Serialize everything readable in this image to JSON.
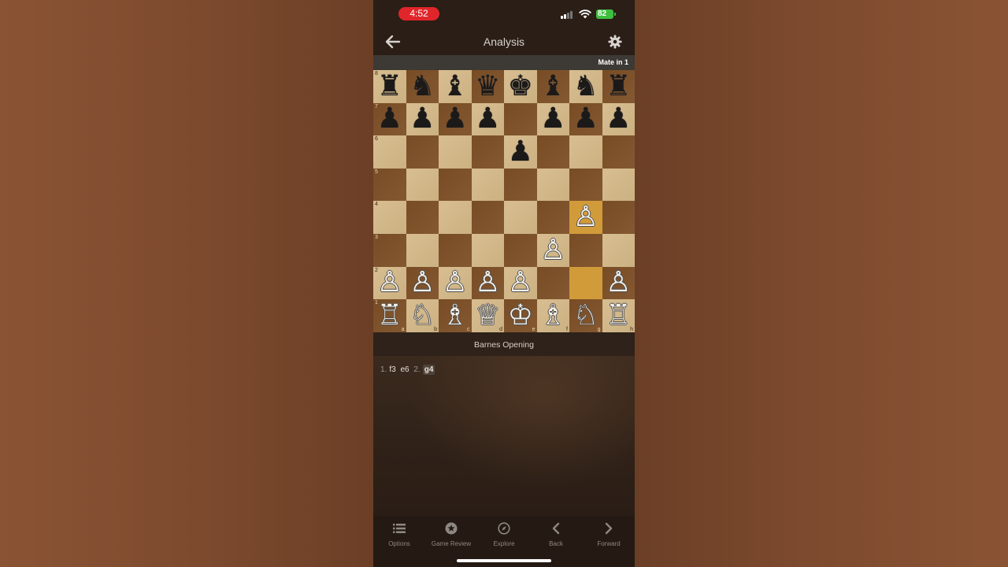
{
  "status": {
    "time": "4:52",
    "battery": "82"
  },
  "header": {
    "title": "Analysis"
  },
  "eval": {
    "text": "Mate in 1"
  },
  "board": {
    "ranks": [
      [
        "♜",
        "♞",
        "♝",
        "♛",
        "♚",
        "♝",
        "♞",
        "♜"
      ],
      [
        "♟",
        "♟",
        "♟",
        "♟",
        "",
        "♟",
        "♟",
        "♟"
      ],
      [
        "",
        "",
        "",
        "",
        "♟",
        "",
        "",
        ""
      ],
      [
        "",
        "",
        "",
        "",
        "",
        "",
        "",
        ""
      ],
      [
        "",
        "",
        "",
        "",
        "",
        "",
        "♙",
        ""
      ],
      [
        "",
        "",
        "",
        "",
        "",
        "♙",
        "",
        ""
      ],
      [
        "♙",
        "♙",
        "♙",
        "♙",
        "♙",
        "",
        "",
        "♙"
      ],
      [
        "♖",
        "♘",
        "♗",
        "♕",
        "♔",
        "♗",
        "♘",
        "♖"
      ]
    ],
    "rank_labels": [
      "8",
      "7",
      "6",
      "5",
      "4",
      "3",
      "2",
      "1"
    ],
    "file_labels": [
      "a",
      "b",
      "c",
      "d",
      "e",
      "f",
      "g",
      "h"
    ],
    "highlights": [
      "g4",
      "g2"
    ]
  },
  "opening": {
    "name": "Barnes Opening"
  },
  "moves": {
    "n1": "1.",
    "m1w": "f3",
    "m1b": "e6",
    "n2": "2.",
    "m2w": "g4"
  },
  "nav": {
    "options": "Options",
    "review": "Game Review",
    "explore": "Explore",
    "back": "Back",
    "forward": "Forward"
  },
  "colors": {
    "highlight": "#d29b3a",
    "eval_bar": "#3d3935",
    "time_pill": "#e0262a"
  }
}
